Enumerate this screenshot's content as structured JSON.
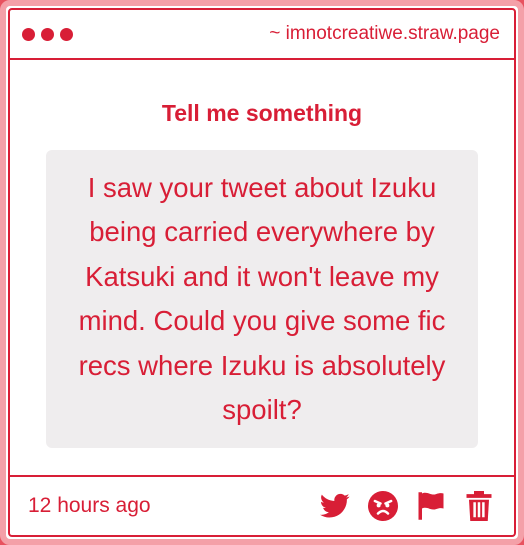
{
  "titlebar": {
    "url": "~ imnotcreatiwe.straw.page"
  },
  "main": {
    "prompt": "Tell me something",
    "question": "I saw your tweet about Izuku being carried everywhere by Katsuki and it won't leave my mind. Could you give some fic recs where Izuku is absolutely spoilt?"
  },
  "footer": {
    "timestamp": "12 hours ago",
    "actions": [
      "twitter-icon",
      "angry-face-icon",
      "flag-icon",
      "trash-icon"
    ]
  },
  "colors": {
    "accent": "#d81e36",
    "background": "#e8525f",
    "question_bg": "#efedee"
  }
}
